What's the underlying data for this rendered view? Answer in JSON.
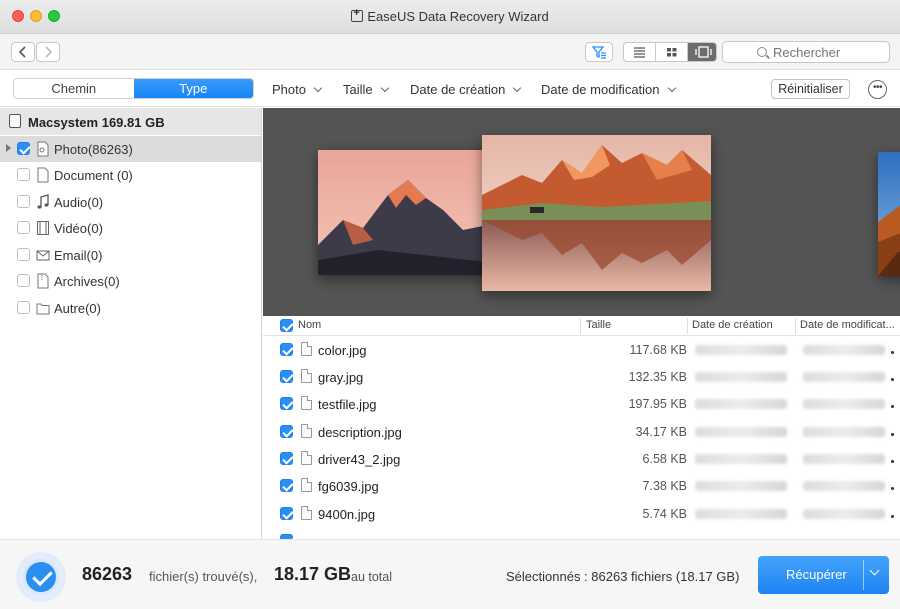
{
  "window": {
    "title": "EaseUS Data Recovery Wizard"
  },
  "toolbar": {
    "search_placeholder": "Rechercher"
  },
  "filters": {
    "tabs": [
      {
        "label": "Chemin",
        "active": false
      },
      {
        "label": "Type",
        "active": true
      }
    ],
    "dropdowns": [
      "Photo",
      "Taille",
      "Date de création",
      "Date de modification"
    ],
    "reset_label": "Réinitialiser",
    "more_icon": "ellipsis-icon"
  },
  "sidebar": {
    "disk_label": "Macsystem 169.81 GB",
    "items": [
      {
        "label": "Photo(86263)",
        "icon": "photo-file-icon",
        "checked": true,
        "selected": true
      },
      {
        "label": "Document (0)",
        "icon": "document-icon",
        "checked": false,
        "selected": false
      },
      {
        "label": "Audio(0)",
        "icon": "music-note-icon",
        "checked": false,
        "selected": false
      },
      {
        "label": "Vidéo(0)",
        "icon": "film-icon",
        "checked": false,
        "selected": false
      },
      {
        "label": "Email(0)",
        "icon": "envelope-icon",
        "checked": false,
        "selected": false
      },
      {
        "label": "Archives(0)",
        "icon": "archive-icon",
        "checked": false,
        "selected": false
      },
      {
        "label": "Autre(0)",
        "icon": "folder-icon",
        "checked": false,
        "selected": false
      }
    ]
  },
  "table": {
    "columns": [
      "Nom",
      "Taille",
      "Date de création",
      "Date de modificat..."
    ],
    "rows": [
      {
        "name": "color.jpg",
        "size": "117.68 KB"
      },
      {
        "name": "gray.jpg",
        "size": "132.35 KB"
      },
      {
        "name": "testfile.jpg",
        "size": "197.95 KB"
      },
      {
        "name": "description.jpg",
        "size": "34.17 KB"
      },
      {
        "name": "driver43_2.jpg",
        "size": "6.58 KB"
      },
      {
        "name": "fg6039.jpg",
        "size": "7.38 KB"
      },
      {
        "name": "9400n.jpg",
        "size": "5.74 KB"
      }
    ]
  },
  "footer": {
    "found_count": "86263",
    "found_text": "fichier(s) trouvé(s),",
    "total_size": "18.17 GB",
    "total_text": "au total",
    "selected_text": "Sélectionnés : 86263 fichiers (18.17 GB)",
    "recover_label": "Récupérer"
  },
  "colors": {
    "accent": "#1f87f5",
    "preview_bg": "#545454"
  }
}
